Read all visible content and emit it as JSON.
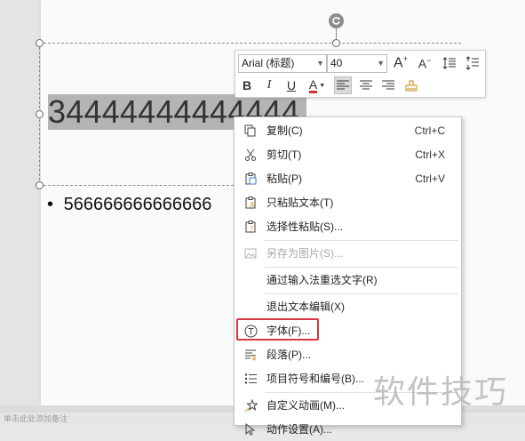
{
  "slide": {
    "selected_text": "34444444444444",
    "bullet_char": "•",
    "bullet_text": "566666666666666"
  },
  "mini_toolbar": {
    "font_name": "Arial (标题)",
    "font_size": "40",
    "bold": "B",
    "italic": "I",
    "underline": "U",
    "font_color_letter": "A",
    "font_color": "#d92b2b",
    "grow_font": "A",
    "shrink_font": "A"
  },
  "context_menu": {
    "items": [
      {
        "label": "复制(C)",
        "shortcut": "Ctrl+C",
        "icon": "copy-icon",
        "enabled": true
      },
      {
        "label": "剪切(T)",
        "shortcut": "Ctrl+X",
        "icon": "scissors-icon",
        "enabled": true
      },
      {
        "label": "粘贴(P)",
        "shortcut": "Ctrl+V",
        "icon": "paste-icon",
        "enabled": true
      },
      {
        "label": "只粘贴文本(T)",
        "shortcut": "",
        "icon": "paste-text-icon",
        "enabled": true
      },
      {
        "label": "选择性粘贴(S)...",
        "shortcut": "",
        "icon": "paste-special-icon",
        "enabled": true
      },
      {
        "label": "另存为图片(S)...",
        "shortcut": "",
        "icon": "save-image-icon",
        "enabled": false
      },
      {
        "label": "通过输入法重选文字(R)",
        "shortcut": "",
        "icon": "",
        "enabled": true
      },
      {
        "label": "退出文本编辑(X)",
        "shortcut": "",
        "icon": "",
        "enabled": true
      },
      {
        "label": "字体(F)...",
        "shortcut": "",
        "icon": "font-icon",
        "enabled": true
      },
      {
        "label": "段落(P)...",
        "shortcut": "",
        "icon": "paragraph-icon",
        "enabled": true
      },
      {
        "label": "项目符号和编号(B)...",
        "shortcut": "",
        "icon": "bullets-icon",
        "enabled": true
      },
      {
        "label": "自定义动画(M)...",
        "shortcut": "",
        "icon": "animation-icon",
        "enabled": true
      },
      {
        "label": "动作设置(A)...",
        "shortcut": "",
        "icon": "action-icon",
        "enabled": true
      }
    ],
    "highlighted_item": "字体(F)...",
    "highlight_color": "#d9363e"
  },
  "watermark": "软件技巧",
  "statusbar": {
    "text": "单击此处添加备注"
  }
}
